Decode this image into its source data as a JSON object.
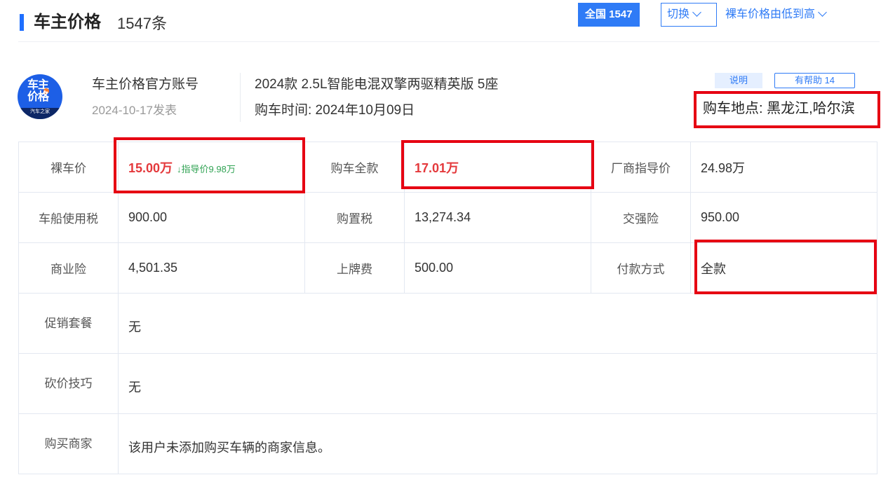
{
  "header": {
    "title": "车主价格",
    "count": "1547条",
    "scope_button": "全国 1547",
    "switch_button": "切换",
    "sort_link": "裸车价格由低到高"
  },
  "post": {
    "avatar_line1": "车主",
    "avatar_line2": "价格",
    "avatar_footer": "汽车之家",
    "account_name": "车主价格官方账号",
    "post_date": "2024-10-17发表",
    "model": "2024款 2.5L智能电混双擎两驱精英版 5座",
    "buy_time": "购车时间:  2024年10月09日",
    "explain_badge": "说明",
    "helpful_badge": "有帮助 14",
    "location": "购车地点: 黑龙江,哈尔滨"
  },
  "table": {
    "bare_price_label": "裸车价",
    "bare_price_value": "15.00万",
    "bare_price_guide": "↓指导价9.98万",
    "full_price_label": "购车全款",
    "full_price_value": "17.01万",
    "msrp_label": "厂商指导价",
    "msrp_value": "24.98万",
    "vessel_tax_label": "车船使用税",
    "vessel_tax_value": "900.00",
    "purchase_tax_label": "购置税",
    "purchase_tax_value": "13,274.34",
    "compulsory_ins_label": "交强险",
    "compulsory_ins_value": "950.00",
    "commercial_ins_label": "商业险",
    "commercial_ins_value": "4,501.35",
    "plate_fee_label": "上牌费",
    "plate_fee_value": "500.00",
    "payment_label": "付款方式",
    "payment_value": "全款",
    "promo_label": "促销套餐",
    "promo_value": "无",
    "bargain_label": "砍价技巧",
    "bargain_value": "无",
    "dealer_label": "购买商家",
    "dealer_value": "该用户未添加购买车辆的商家信息。"
  },
  "icons": {
    "switch_chevron": "chevron-down-icon",
    "sort_chevron": "chevron-down-icon"
  },
  "colors": {
    "accent": "#2f7bf6",
    "price_red": "#e4393c",
    "guide_green": "#31a354",
    "highlight": "#e60012"
  }
}
